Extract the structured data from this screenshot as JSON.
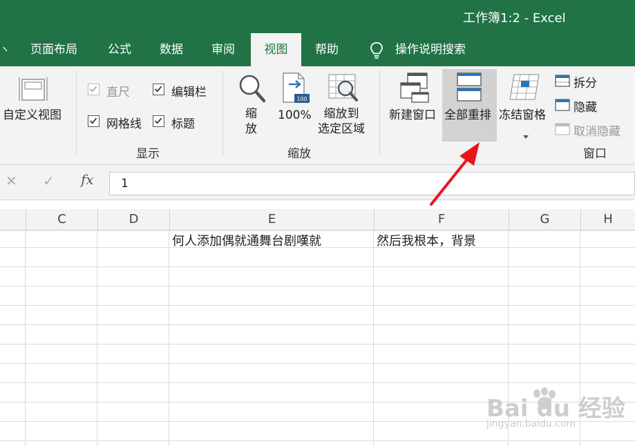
{
  "window": {
    "title": "工作簿1:2  -  Excel"
  },
  "tabs": [
    {
      "label": "页面布局"
    },
    {
      "label": "公式"
    },
    {
      "label": "数据"
    },
    {
      "label": "审阅"
    },
    {
      "label": "视图"
    },
    {
      "label": "帮助"
    }
  ],
  "tell_me": {
    "label": "操作说明搜索",
    "icon": "lightbulb-icon"
  },
  "ribbon": {
    "custom_view": "自定义视图",
    "show_group": {
      "label": "显示",
      "ruler": "直尺",
      "formula_bar": "编辑栏",
      "gridlines": "网格线",
      "headings": "标题"
    },
    "zoom_group": {
      "label": "缩放",
      "zoom_line1": "缩",
      "zoom_line2": "放",
      "zoom100": "100%",
      "zoom100_badge": "100",
      "zoom_sel_line1": "缩放到",
      "zoom_sel_line2": "选定区域"
    },
    "window_group": {
      "label": "窗口",
      "new_window": "新建窗口",
      "arrange_all": "全部重排",
      "freeze_panes": "冻结窗格",
      "split": "拆分",
      "hide": "隐藏",
      "unhide": "取消隐藏"
    }
  },
  "formula_bar": {
    "cancel": "✕",
    "enter": "✓",
    "fx": "fx",
    "value": "1"
  },
  "columns": [
    "C",
    "D",
    "E",
    "F",
    "G",
    "H"
  ],
  "cells": {
    "E1": "何人添加偶就通舞台剧嘆就",
    "F1": "然后我根本，背景"
  },
  "watermark": {
    "logo": "Bai du 经验",
    "url": "jingyan.baidu.com"
  },
  "colors": {
    "excel_green": "#217346",
    "highlight_gray": "#d2d2d2",
    "annotation_red": "#e8161b"
  }
}
